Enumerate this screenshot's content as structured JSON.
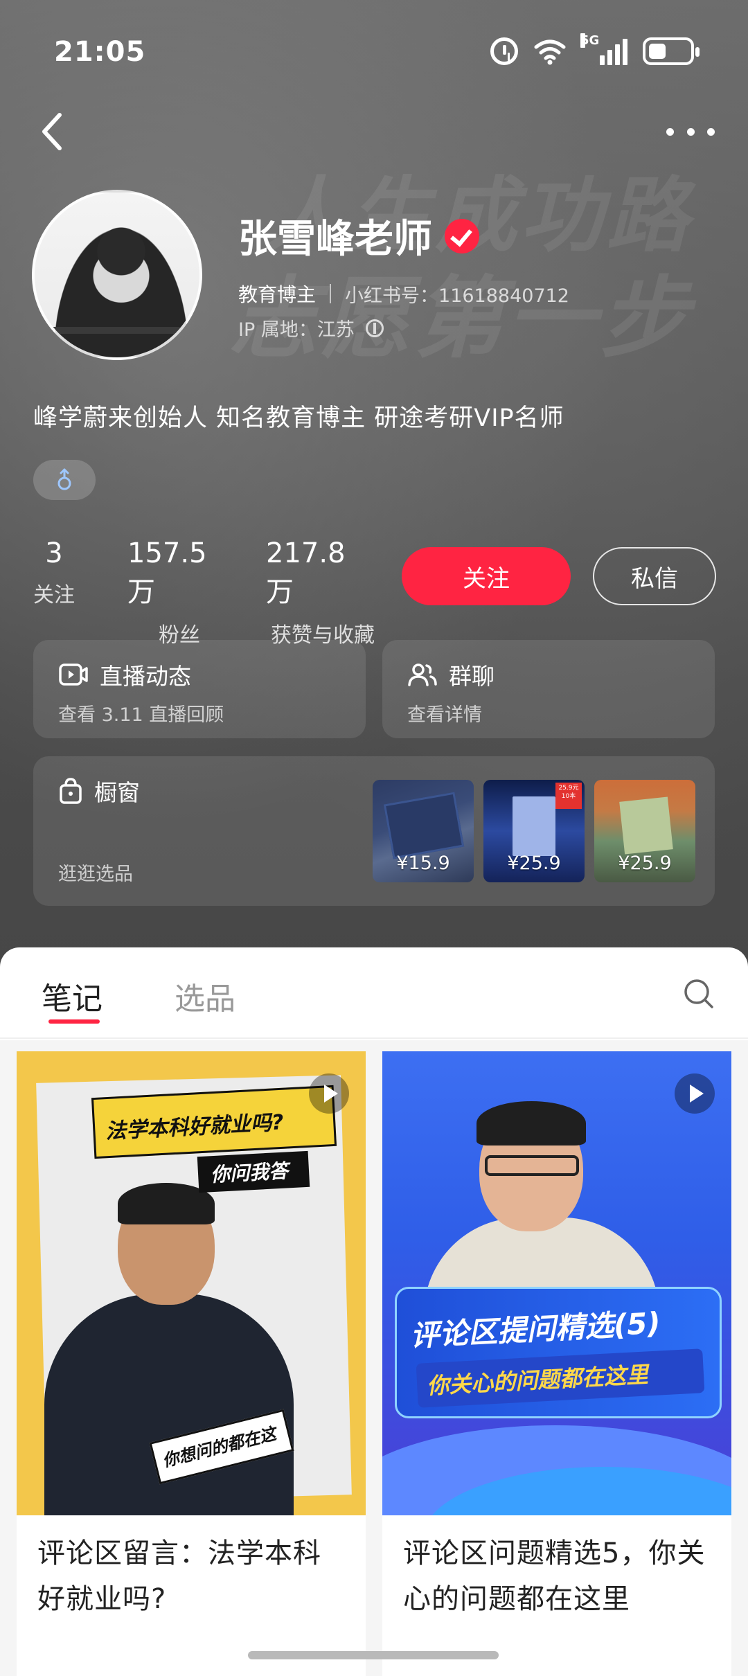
{
  "status_bar": {
    "time": "21:05",
    "network": "5G",
    "icons": [
      "alarm-icon",
      "wifi-icon",
      "signal-icon",
      "battery-icon"
    ]
  },
  "nav": {
    "back_icon": "back-icon",
    "more_icon": "more-icon"
  },
  "hero_watermark": {
    "line1": "人生成功路",
    "line2": "志愿第一步"
  },
  "profile": {
    "name": "张雪峰老师",
    "verified": true,
    "category": "教育博主",
    "id_text": "小红书号：11618840712",
    "ip_text": "IP 属地：江苏",
    "bio": "峰学蔚来创始人 知名教育博主 研途考研VIP名师",
    "gender": "male"
  },
  "stats": [
    {
      "value": "3",
      "label": "关注"
    },
    {
      "value": "157.5 万",
      "label": "粉丝"
    },
    {
      "value": "217.8 万",
      "label": "获赞与收藏"
    }
  ],
  "actions": {
    "follow": "关注",
    "message": "私信"
  },
  "cards": {
    "live": {
      "title": "直播动态",
      "subtitle": "查看 3.11 直播回顾"
    },
    "group": {
      "title": "群聊",
      "subtitle": "查看详情"
    },
    "shop": {
      "title": "橱窗",
      "subtitle": "逛逛选品",
      "items": [
        {
          "price": "¥15.9"
        },
        {
          "price": "¥25.9",
          "badge": "25.9元 10本"
        },
        {
          "price": "¥25.9"
        }
      ]
    }
  },
  "tabs": {
    "notes": "笔记",
    "products": "选品",
    "active": "notes"
  },
  "feed": [
    {
      "title": "评论区留言：法学本科好就业吗?",
      "cover_headline": "法学本科好就业吗?",
      "cover_sub": "你问我答",
      "cover_bubble": "你想问的都在这",
      "is_video": true
    },
    {
      "title": "评论区问题精选5，你关心的问题都在这里",
      "cover_headline": "评论区提问精选(5)",
      "cover_sub": "你关心的问题都在这里",
      "is_video": true
    }
  ],
  "colors": {
    "accent": "#ff2442",
    "hero_bg": "#5a5a5a",
    "sheet_bg": "#ffffff"
  }
}
